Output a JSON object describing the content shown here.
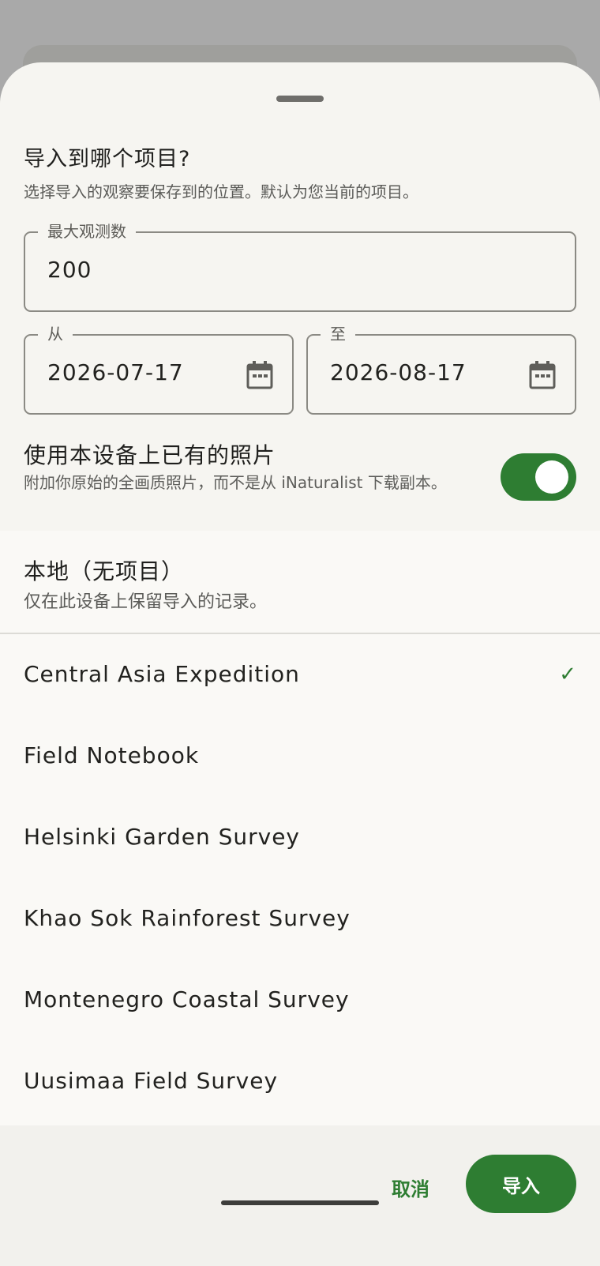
{
  "sheet": {
    "title": "导入到哪个项目?",
    "subtitle": "选择导入的观察要保存到的位置。默认为您当前的项目。"
  },
  "max_observations": {
    "label": "最大观测数",
    "value": "200"
  },
  "date_from": {
    "label": "从",
    "value": "2026-07-17",
    "icon": "calendar-icon"
  },
  "date_to": {
    "label": "至",
    "value": "2026-08-17",
    "icon": "calendar-icon"
  },
  "device_photos": {
    "title": "使用本设备上已有的照片",
    "description": "附加你原始的全画质照片，而不是从 iNaturalist 下载副本。",
    "enabled": true,
    "accent_color": "#2e7d32"
  },
  "local_option": {
    "title": "本地（无项目）",
    "description": "仅在此设备上保留导入的记录。"
  },
  "projects": [
    {
      "label": "Central Asia Expedition",
      "selected": true
    },
    {
      "label": "Field Notebook",
      "selected": false
    },
    {
      "label": "Helsinki Garden Survey",
      "selected": false
    },
    {
      "label": "Khao Sok Rainforest Survey",
      "selected": false
    },
    {
      "label": "Montenegro Coastal Survey",
      "selected": false
    },
    {
      "label": "Uusimaa Field Survey",
      "selected": false
    }
  ],
  "check_mark": "✓",
  "actions": {
    "cancel_label": "取消",
    "import_label": "导入"
  }
}
